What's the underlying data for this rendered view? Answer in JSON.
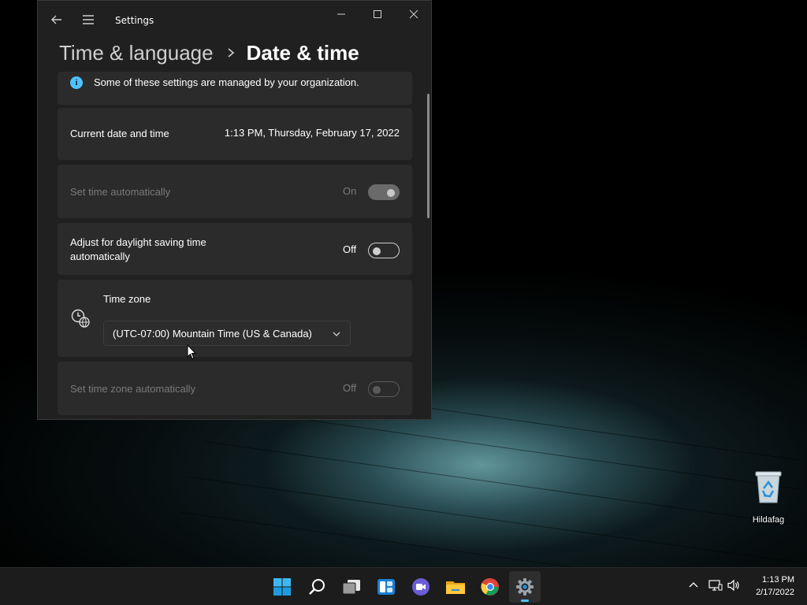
{
  "window": {
    "title": "Settings",
    "breadcrumb": {
      "parent": "Time & language",
      "current": "Date & time"
    }
  },
  "info_bar": {
    "text": "Some of these settings are managed by your organization."
  },
  "settings": {
    "current_datetime": {
      "label": "Current date and time",
      "value": "1:13 PM, Thursday, February 17, 2022"
    },
    "set_time_auto": {
      "label": "Set time automatically",
      "state": "On"
    },
    "daylight_saving": {
      "label_line1": "Adjust for daylight saving time",
      "label_line2": "automatically",
      "state": "Off"
    },
    "time_zone": {
      "label": "Time zone",
      "selected": "(UTC-07:00) Mountain Time (US & Canada)"
    },
    "set_tz_auto": {
      "label": "Set time zone automatically",
      "state": "Off"
    }
  },
  "desktop": {
    "recycle_bin_label": "Hildafag"
  },
  "taskbar": {
    "apps": [
      "start-icon",
      "search-icon",
      "task-view-icon",
      "widgets-icon",
      "teams-chat-icon",
      "file-explorer-icon",
      "chrome-icon",
      "settings-icon"
    ],
    "clock": {
      "time": "1:13 PM",
      "date": "2/17/2022"
    }
  },
  "colors": {
    "accent": "#4cc2ff",
    "window_bg": "#202020",
    "card_bg": "#2b2b2b",
    "taskbar_bg": "#1c1c1c"
  }
}
